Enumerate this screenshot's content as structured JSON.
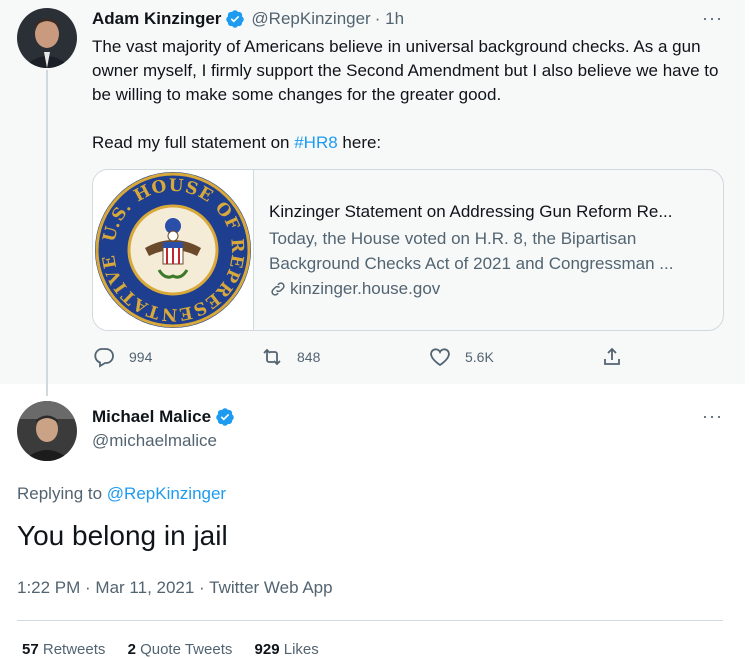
{
  "parent_tweet": {
    "author_name": "Adam Kinzinger",
    "handle": "@RepKinzinger",
    "time": "· 1h",
    "text_1": "The vast majority of Americans believe in universal background checks. As a gun owner myself, I firmly support the Second Amendment but I also believe we have to be willing to make some changes for the greater good.",
    "text_2_prefix": "Read my full statement on ",
    "hashtag": "#HR8",
    "text_2_suffix": " here:",
    "card": {
      "title": "Kinzinger Statement on Addressing Gun Reform Re...",
      "description": "Today, the House voted on H.R. 8, the Bipartisan Background Checks Act of 2021 and Congressman ...",
      "domain": "kinzinger.house.gov",
      "seal_text": "U.S. HOUSE OF REPRESENTATIVES"
    },
    "actions": {
      "replies": "994",
      "retweets": "848",
      "likes": "5.6K"
    }
  },
  "reply_tweet": {
    "author_name": "Michael Malice",
    "handle": "@michaelmalice",
    "replying_to_prefix": "Replying to ",
    "replying_to_handle": "@RepKinzinger",
    "text": "You belong in jail",
    "timestamp": "1:22 PM · Mar 11, 2021 · Twitter Web App",
    "stats": {
      "retweets_count": "57",
      "retweets_label": "Retweets",
      "quote_count": "2",
      "quote_label": "Quote Tweets",
      "likes_count": "929",
      "likes_label": "Likes"
    }
  },
  "icons": {
    "more": "···",
    "verified": "verified-badge-icon",
    "reply": "reply-icon",
    "retweet": "retweet-icon",
    "like": "heart-icon",
    "share": "share-icon",
    "link": "link-icon"
  },
  "colors": {
    "accent": "#1d9bf0",
    "text": "#0f1419",
    "secondary": "#536471",
    "parent_bg": "#f7f9f9",
    "border": "#cfd9de"
  }
}
